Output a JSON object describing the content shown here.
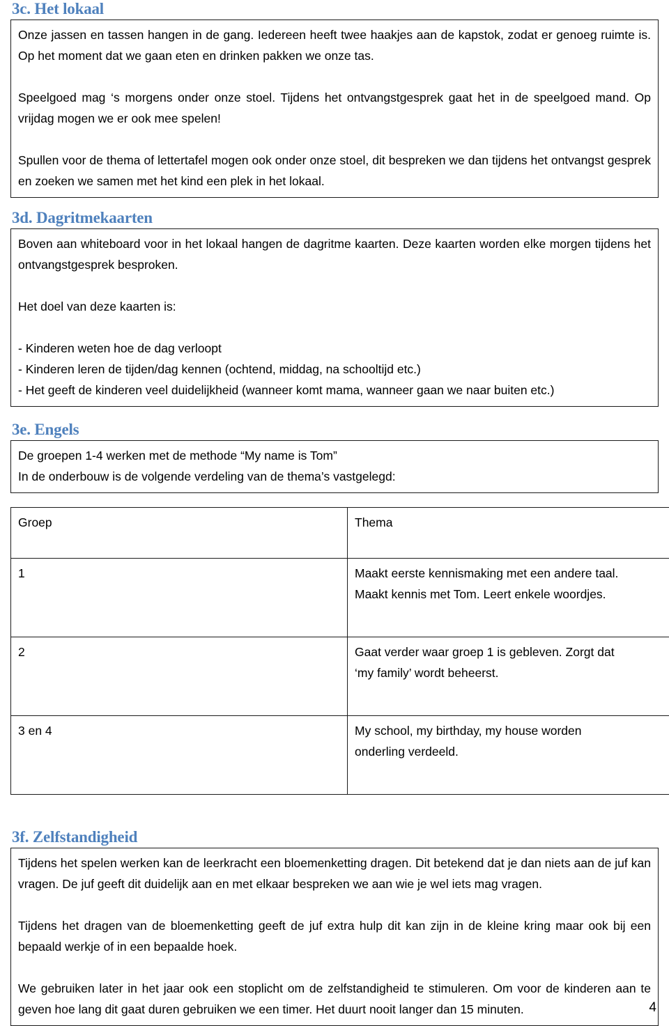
{
  "document": {
    "page_number": "4",
    "accent_color": "#4F81BD",
    "border_color": "#1a1a1a"
  },
  "sections": [
    {
      "id": "3c",
      "heading": "3c. Het lokaal",
      "paragraphs": [
        "Onze jassen en tassen hangen in de gang. Iedereen heeft twee haakjes aan de kapstok, zodat er genoeg ruimte is.  Op het moment dat we gaan eten en drinken pakken we onze tas.",
        "Speelgoed mag ‘s morgens onder onze stoel. Tijdens het ontvangstgesprek gaat het in de speelgoed mand. Op vrijdag mogen we er ook mee spelen!",
        "Spullen voor de thema of lettertafel mogen ook onder onze stoel, dit bespreken we dan tijdens het ontvangst gesprek en zoeken we samen met het kind een plek in het lokaal."
      ]
    },
    {
      "id": "3d",
      "heading": "3d. Dagritmekaarten",
      "paragraphs": [
        "Boven aan whiteboard voor in het lokaal hangen de dagritme kaarten. Deze kaarten worden elke morgen tijdens het ontvangstgesprek besproken.",
        " Het doel van deze kaarten is:"
      ],
      "bullets": [
        "- Kinderen weten hoe de dag verloopt",
        "- Kinderen leren de tijden/dag kennen (ochtend, middag, na schooltijd etc.)",
        "- Het geeft de kinderen veel duidelijkheid (wanneer komt mama, wanneer gaan we naar buiten etc.)"
      ]
    },
    {
      "id": "3e",
      "heading": "3e. Engels",
      "paragraphs": [
        "De groepen 1-4 werken met de methode  “My name is Tom”",
        "In de onderbouw is de volgende verdeling van de thema’s vastgelegd:"
      ]
    },
    {
      "id": "3f",
      "heading": "3f. Zelfstandigheid",
      "paragraphs": [
        "Tijdens het spelen werken kan de leerkracht een bloemenketting dragen. Dit betekend dat je dan niets aan de juf kan vragen. De juf geeft dit duidelijk aan en met elkaar bespreken we aan wie je wel iets mag vragen.",
        "Tijdens het dragen van de bloemenketting geeft de juf extra hulp dit kan zijn in de kleine kring maar ook bij een bepaald werkje of in een bepaalde hoek.",
        "We gebruiken later in het jaar ook een stoplicht om de zelfstandigheid te stimuleren. Om voor de kinderen aan te geven hoe lang dit gaat duren gebruiken we een timer. Het duurt nooit langer dan 15 minuten."
      ]
    }
  ],
  "theme_table": {
    "headers": [
      "Groep",
      "Thema"
    ],
    "rows": [
      {
        "groep": "1",
        "thema_line1": "Maakt eerste kennismaking met een andere taal.",
        "thema_line2": "Maakt kennis met Tom. Leert enkele woordjes."
      },
      {
        "groep": "2",
        "thema_line1": "Gaat verder waar groep 1 is gebleven. Zorgt dat",
        "thema_line2": "‘my family’ wordt beheerst."
      },
      {
        "groep": "3 en 4",
        "thema_line1": "My school, my birthday, my house worden",
        "thema_line2": "onderling verdeeld."
      }
    ]
  }
}
